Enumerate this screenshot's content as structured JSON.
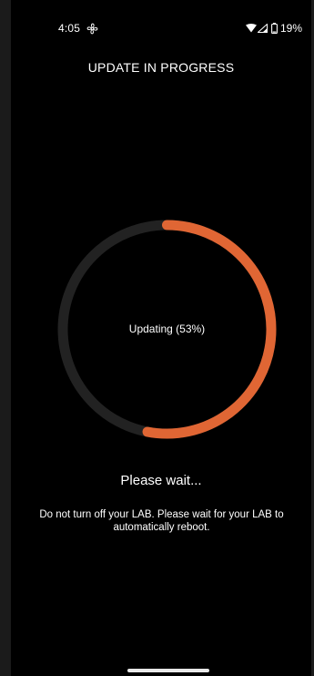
{
  "status_bar": {
    "time": "4:05",
    "battery": "19%",
    "icons": [
      "fan-icon",
      "wifi-icon",
      "signal-icon",
      "battery-icon"
    ]
  },
  "header": {
    "title": "UPDATE IN PROGRESS"
  },
  "progress": {
    "label": "Updating (53%)",
    "percent": 53,
    "track_color": "#222222",
    "fill_color": "#e06634"
  },
  "message": {
    "heading": "Please wait...",
    "body": "Do not turn off your LAB. Please wait for your LAB to automatically reboot."
  }
}
